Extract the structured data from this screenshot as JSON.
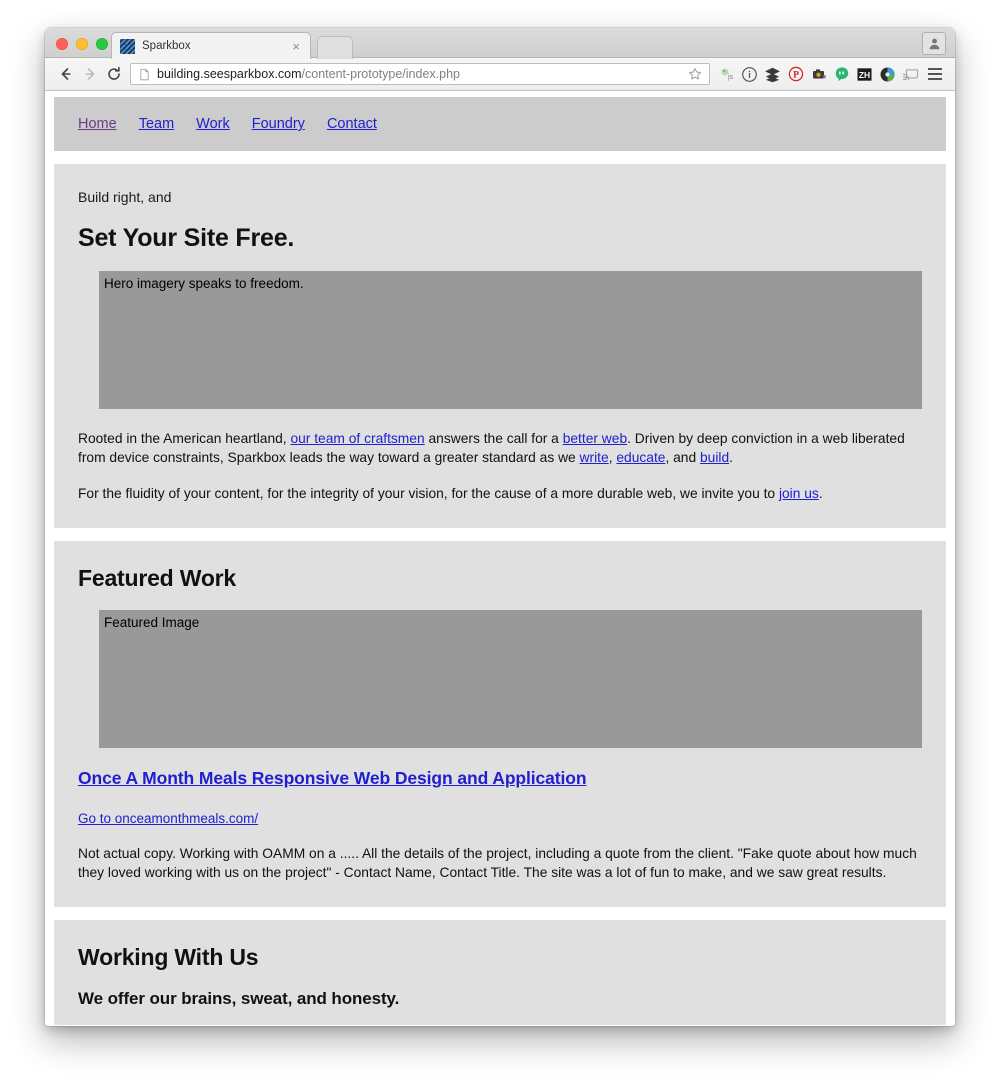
{
  "browser": {
    "tab": {
      "title": "Sparkbox",
      "favicon": "sparkbox-favicon",
      "close_label": "×"
    },
    "url": {
      "host": "building.seesparkbox.com",
      "path": "/content-prototype/index.php"
    },
    "back_label": "←",
    "forward_label": "→",
    "reload_label": "↻",
    "extensions": [
      "javascript-icon",
      "info-circle-icon",
      "layers-icon",
      "pinterest-icon",
      "camera-icon",
      "hangouts-icon",
      "zh-box-icon",
      "colorzilla-icon",
      "cast-icon"
    ],
    "menu_label": "Chrome menu",
    "profile_label": "Profile"
  },
  "site_nav": [
    {
      "label": "Home",
      "visited": true
    },
    {
      "label": "Team",
      "visited": false
    },
    {
      "label": "Work",
      "visited": false
    },
    {
      "label": "Foundry",
      "visited": false
    },
    {
      "label": "Contact",
      "visited": false
    }
  ],
  "hero": {
    "eyebrow": "Build right, and",
    "heading": "Set Your Site Free.",
    "image_alt": "Hero imagery speaks to freedom.",
    "paragraph_1": {
      "part_1": "Rooted in the American heartland, ",
      "link_1": "our team of craftsmen",
      "part_2": " answers the call for a ",
      "link_2": "better web",
      "part_3": ". Driven by deep conviction in a web liberated from device constraints, Sparkbox leads the way toward a greater standard as we ",
      "link_3": "write",
      "part_4": ", ",
      "link_4": "educate",
      "part_5": ", and ",
      "link_5": "build",
      "part_6": "."
    },
    "paragraph_2": {
      "part_1": "For the fluidity of your content, for the integrity of your vision, for the cause of a more durable web, we invite you to ",
      "link_1": "join us",
      "part_2": "."
    }
  },
  "featured_work": {
    "heading": "Featured Work",
    "image_alt": "Featured Image",
    "project_title": "Once A Month Meals Responsive Web Design and Application",
    "project_link": "Go to onceamonthmeals.com/",
    "description": "Not actual copy. Working with OAMM on a ..... All the details of the project, including a quote from the client. \"Fake quote about how much they loved working with us on the project\" - Contact Name, Contact Title. The site was a lot of fun to make, and we saw great results."
  },
  "working_with_us": {
    "heading": "Working With Us",
    "subheading": "We offer our brains, sweat, and honesty."
  }
}
